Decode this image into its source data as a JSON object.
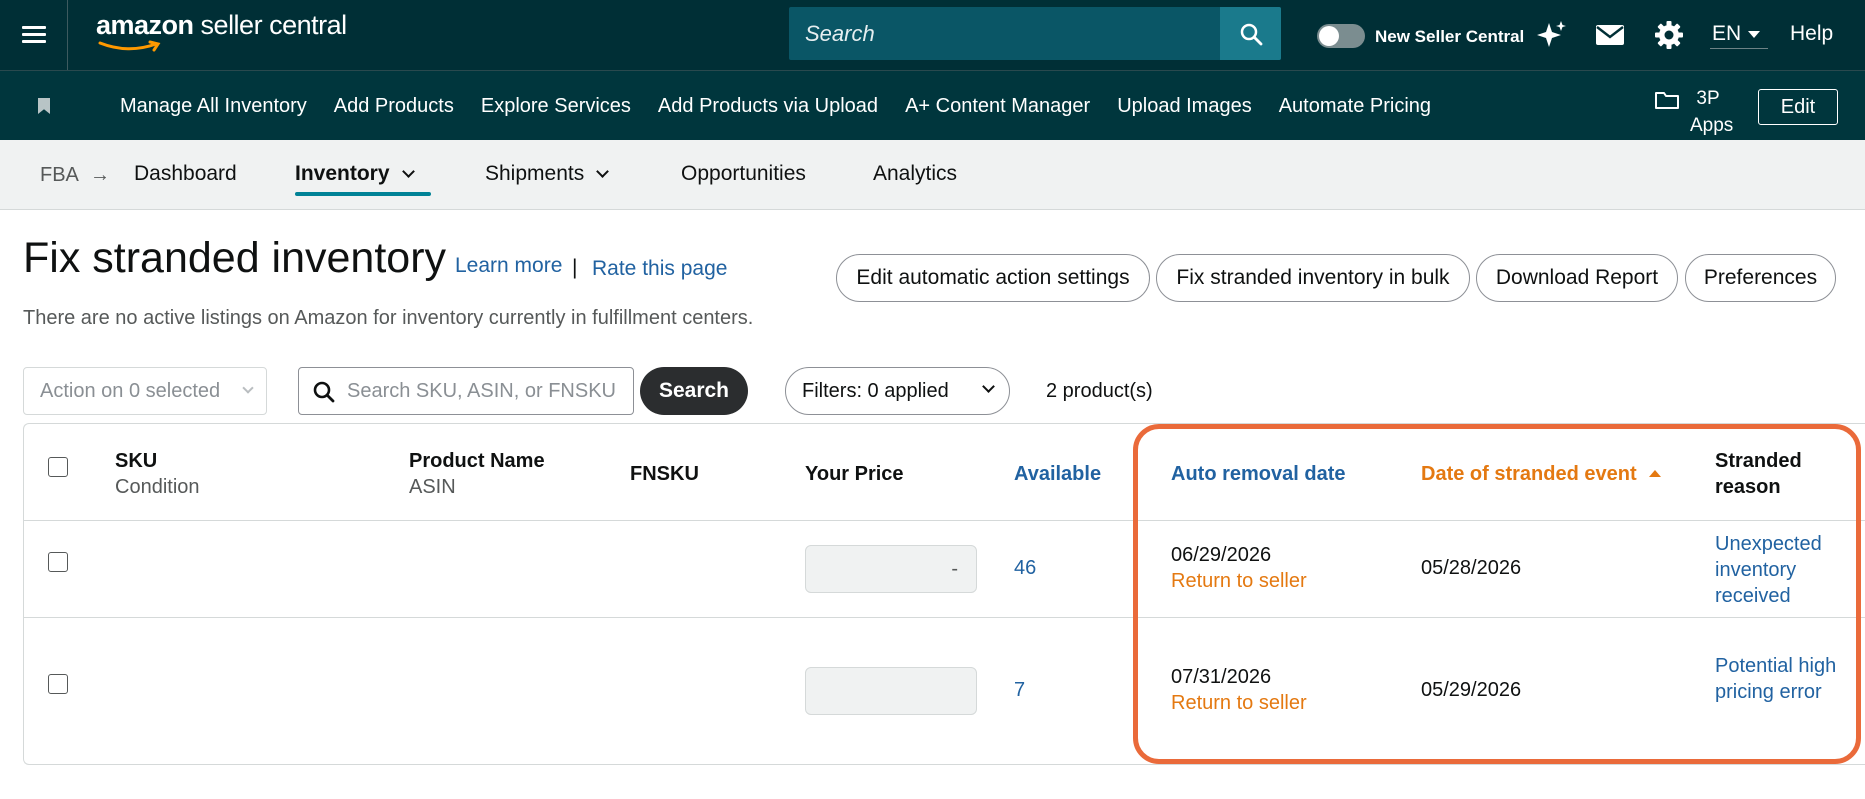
{
  "header": {
    "logo_brand": "amazon",
    "logo_suffix": "seller central",
    "search_placeholder": "Search",
    "toggle_label": "New Seller Central",
    "language": "EN",
    "help": "Help",
    "icons": [
      "menu-icon",
      "search-icon",
      "sparkle-icon",
      "mail-icon",
      "gear-icon"
    ]
  },
  "nav": {
    "links": [
      "Manage All Inventory",
      "Add Products",
      "Explore Services",
      "Add Products via Upload",
      "A+ Content Manager",
      "Upload Images",
      "Automate Pricing"
    ],
    "apps_label": "3P Apps",
    "edit_label": "Edit"
  },
  "subnav": {
    "crumb": "FBA",
    "tabs": [
      "Dashboard",
      "Inventory",
      "Shipments",
      "Opportunities",
      "Analytics"
    ],
    "active_tab": "Inventory"
  },
  "page": {
    "title": "Fix stranded inventory",
    "learn_more": "Learn more",
    "separator": "|",
    "rate": "Rate this page",
    "subtitle": "There are no active listings on Amazon for inventory currently in fulfillment centers.",
    "buttons": [
      "Edit automatic action settings",
      "Fix stranded inventory in bulk",
      "Download Report",
      "Preferences"
    ]
  },
  "toolbar": {
    "action_label": "Action on 0 selected",
    "search_placeholder": "Search SKU, ASIN, or FNSKU",
    "search_button": "Search",
    "filters_label": "Filters: 0 applied",
    "count": "2 product(s)"
  },
  "table": {
    "columns": {
      "sku": "SKU",
      "sku_sub": "Condition",
      "product": "Product Name",
      "product_sub": "ASIN",
      "fnsku": "FNSKU",
      "price": "Your Price",
      "available": "Available",
      "auto_removal": "Auto removal date",
      "stranded_date": "Date of stranded event",
      "reason_1": "Stranded",
      "reason_2": "reason"
    },
    "rows": [
      {
        "price": "-",
        "available": "46",
        "auto_removal_date": "06/29/2026",
        "auto_removal_action": "Return to seller",
        "stranded_date": "05/28/2026",
        "reason": "Unexpected inventory received"
      },
      {
        "price": "",
        "available": "7",
        "auto_removal_date": "07/31/2026",
        "auto_removal_action": "Return to seller",
        "stranded_date": "05/29/2026",
        "reason": "Potential high pricing error"
      }
    ]
  },
  "colors": {
    "header_bg": "#002f36",
    "nav_bg": "#00363d",
    "link": "#2162a1",
    "accent_orange": "#e47911",
    "highlight_box": "#ea6a3a",
    "active_underline": "#008296"
  }
}
